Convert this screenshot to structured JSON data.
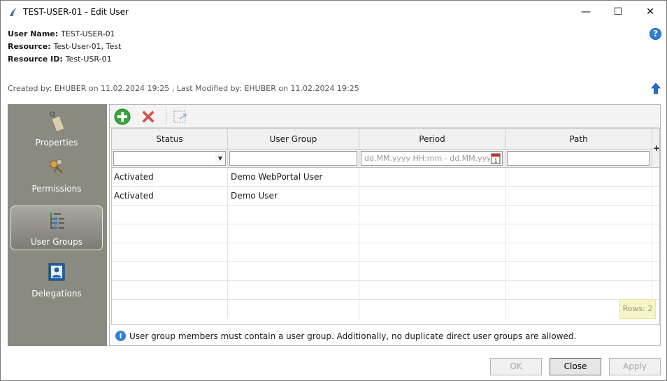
{
  "window": {
    "title": "TEST-USER-01 - Edit User",
    "min_glyph": "—",
    "max_glyph": "☐",
    "close_glyph": "✕"
  },
  "info": {
    "user_name_label": "User Name:",
    "user_name": "TEST-USER-01",
    "resource_label": "Resource:",
    "resource": "Test-User-01, Test",
    "resource_id_label": "Resource ID:",
    "resource_id": "Test-USR-01",
    "help_glyph": "?"
  },
  "audit": "Created by: EHUBER on 11.02.2024 19:25 ,  Last Modified by: EHUBER on 11.02.2024 19:25",
  "sidebar": {
    "items": [
      {
        "label": "Properties",
        "icon": "tag-icon"
      },
      {
        "label": "Permissions",
        "icon": "keys-icon"
      },
      {
        "label": "User Groups",
        "icon": "tree-icon",
        "active": true
      },
      {
        "label": "Delegations",
        "icon": "person-card-icon"
      }
    ]
  },
  "table": {
    "columns": [
      "Status",
      "User Group",
      "Period",
      "Path"
    ],
    "period_placeholder": "dd.MM.yyyy HH:mm - dd.MM.yyyy",
    "add_column_glyph": "+",
    "rows": [
      {
        "status": "Activated",
        "group": "Demo WebPortal User",
        "period": "",
        "path": ""
      },
      {
        "status": "Activated",
        "group": "Demo User",
        "period": "",
        "path": ""
      }
    ],
    "rows_count": "Rows: 2"
  },
  "hint": {
    "glyph": "i",
    "text": "User group members must contain a user group. Additionally, no duplicate direct user groups are allowed."
  },
  "buttons": {
    "ok": "OK",
    "close": "Close",
    "apply": "Apply"
  },
  "colors": {
    "sidebar_bg": "#8a8a80",
    "accent": "#2f7fd8",
    "add_green": "#3aa63a",
    "delete_red": "#d9534f"
  }
}
